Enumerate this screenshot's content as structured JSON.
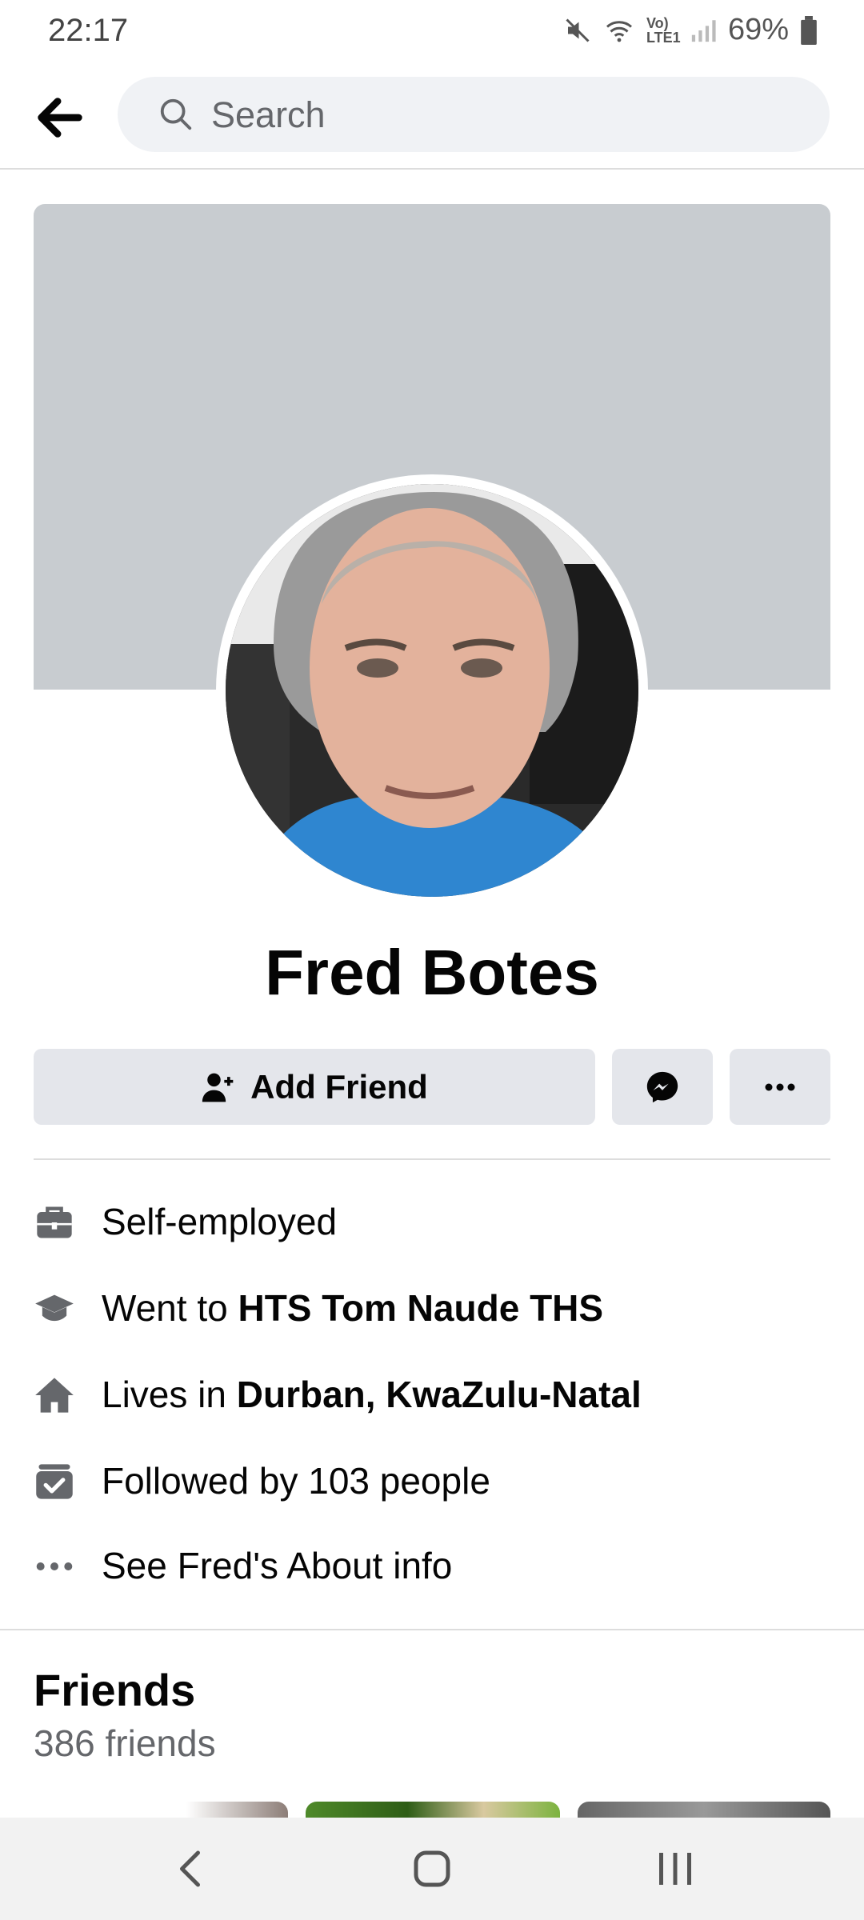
{
  "status_bar": {
    "time": "22:17",
    "network_label": "Vo) LTE1",
    "battery": "69%"
  },
  "search": {
    "placeholder": "Search"
  },
  "profile": {
    "name": "Fred Botes",
    "add_friend_label": "Add Friend"
  },
  "intro": {
    "work": "Self-employed",
    "education_prefix": "Went to ",
    "education_school": "HTS Tom Naude THS",
    "location_prefix": "Lives in ",
    "location_place": "Durban, KwaZulu-Natal",
    "followers": "Followed by 103 people",
    "about_link": "See Fred's About info"
  },
  "friends": {
    "title": "Friends",
    "count": "386 friends"
  },
  "icons": {
    "back": "arrow-left-icon",
    "search": "search-icon",
    "add_friend": "user-plus-icon",
    "messenger": "messenger-icon",
    "more": "more-dots-icon",
    "work": "briefcase-icon",
    "education": "graduation-cap-icon",
    "home": "home-icon",
    "followers": "followers-check-icon",
    "about": "ellipsis-icon"
  },
  "colors": {
    "button_bg": "#e4e6eb",
    "cover_bg": "#c8ccd0",
    "secondary_text": "#65676b"
  }
}
